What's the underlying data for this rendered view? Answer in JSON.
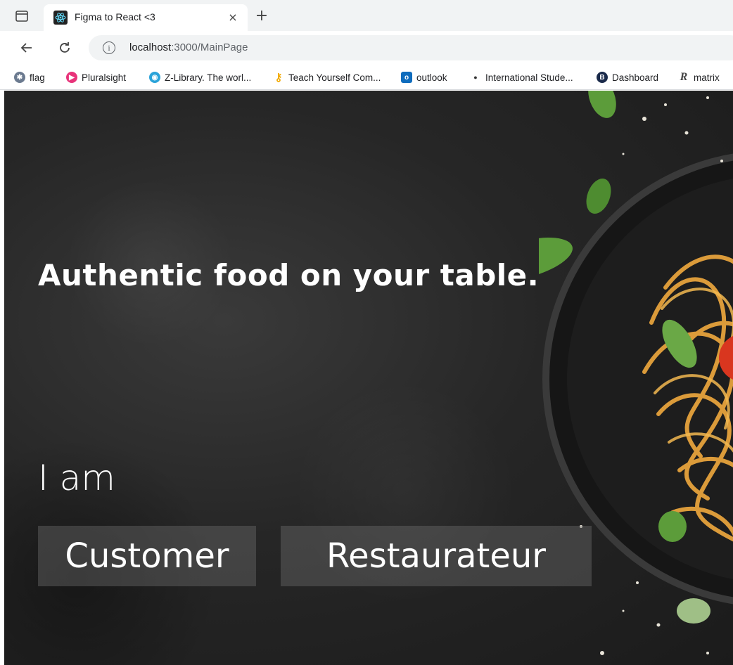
{
  "browser": {
    "tab_title": "Figma to React <3",
    "tab_close": "×",
    "new_tab": "+",
    "url_host": "localhost",
    "url_path": ":3000/MainPage"
  },
  "bookmarks": [
    {
      "label": "flag",
      "icon": "flag-icon",
      "color": "#6b7a8f"
    },
    {
      "label": "Pluralsight",
      "icon": "pluralsight-icon",
      "color": "#e8337a"
    },
    {
      "label": "Z-Library. The worl...",
      "icon": "zlibrary-icon",
      "color": "#2aa3d9"
    },
    {
      "label": "Teach Yourself Com...",
      "icon": "key-icon",
      "color": "#f2a900"
    },
    {
      "label": "outlook",
      "icon": "outlook-icon",
      "color": "#0f6cbd"
    },
    {
      "label": "International Stude...",
      "icon": "dot-icon",
      "color": "#333333"
    },
    {
      "label": "Dashboard",
      "icon": "dashboard-icon",
      "color": "#1a2a4a"
    },
    {
      "label": "matrix",
      "icon": "matrix-icon",
      "color": "#444444"
    }
  ],
  "hero": {
    "headline": "Authentic food on your table.",
    "prompt": "I am",
    "customer_label": "Customer",
    "restaurateur_label": "Restaurateur"
  },
  "colors": {
    "background": "#262626",
    "button_bg": "rgba(110,110,110,0.42)",
    "text": "#ffffff"
  }
}
